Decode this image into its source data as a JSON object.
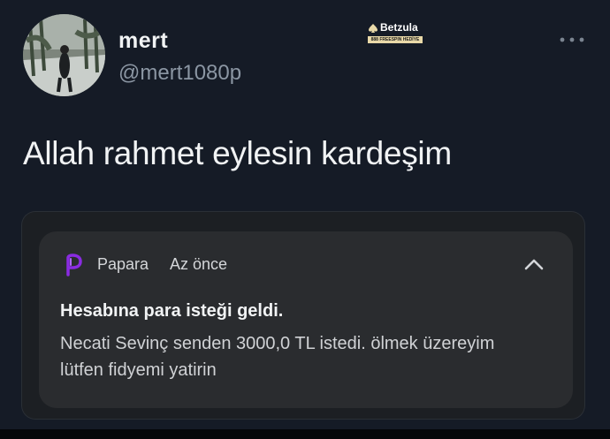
{
  "user": {
    "display_name": "mert",
    "handle": "@mert1080p"
  },
  "tweet": {
    "text": "Allah rahmet eylesin kardeşim"
  },
  "watermark": {
    "brand": "Betzula",
    "tagline": "888 FREESPIN HEDİYE"
  },
  "notification": {
    "app_name": "Papara",
    "time": "Az önce",
    "title": "Hesabına para isteği geldi.",
    "body": "Necati Sevinç senden 3000,0 TL istedi. ölmek üzereyim lütfen fidyemi yatirin"
  },
  "icons": {
    "more": "more-dots-icon",
    "app": "papara-logo-icon",
    "collapse": "chevron-up-icon"
  },
  "colors": {
    "background": "#151b26",
    "notification_bg": "#2a2c2f",
    "papara_accent": "#8a2be2"
  }
}
